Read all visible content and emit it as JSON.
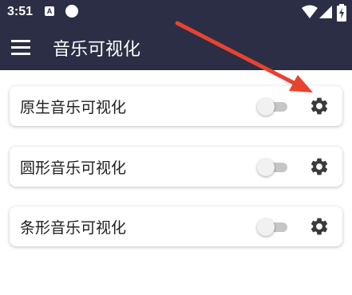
{
  "status_bar": {
    "time": "3:51",
    "notification_letter": "A"
  },
  "app_bar": {
    "title": "音乐可视化",
    "menu_icon": "hamburger-menu-icon"
  },
  "items": [
    {
      "label": "原生音乐可视化",
      "toggle_on": false,
      "settings_icon": "gear-icon"
    },
    {
      "label": "圆形音乐可视化",
      "toggle_on": false,
      "settings_icon": "gear-icon"
    },
    {
      "label": "条形音乐可视化",
      "toggle_on": false,
      "settings_icon": "gear-icon"
    }
  ],
  "colors": {
    "app_bar_bg": "#2b2e45",
    "annotation_arrow": "#e8432f",
    "gear": "#3a3a3a"
  }
}
